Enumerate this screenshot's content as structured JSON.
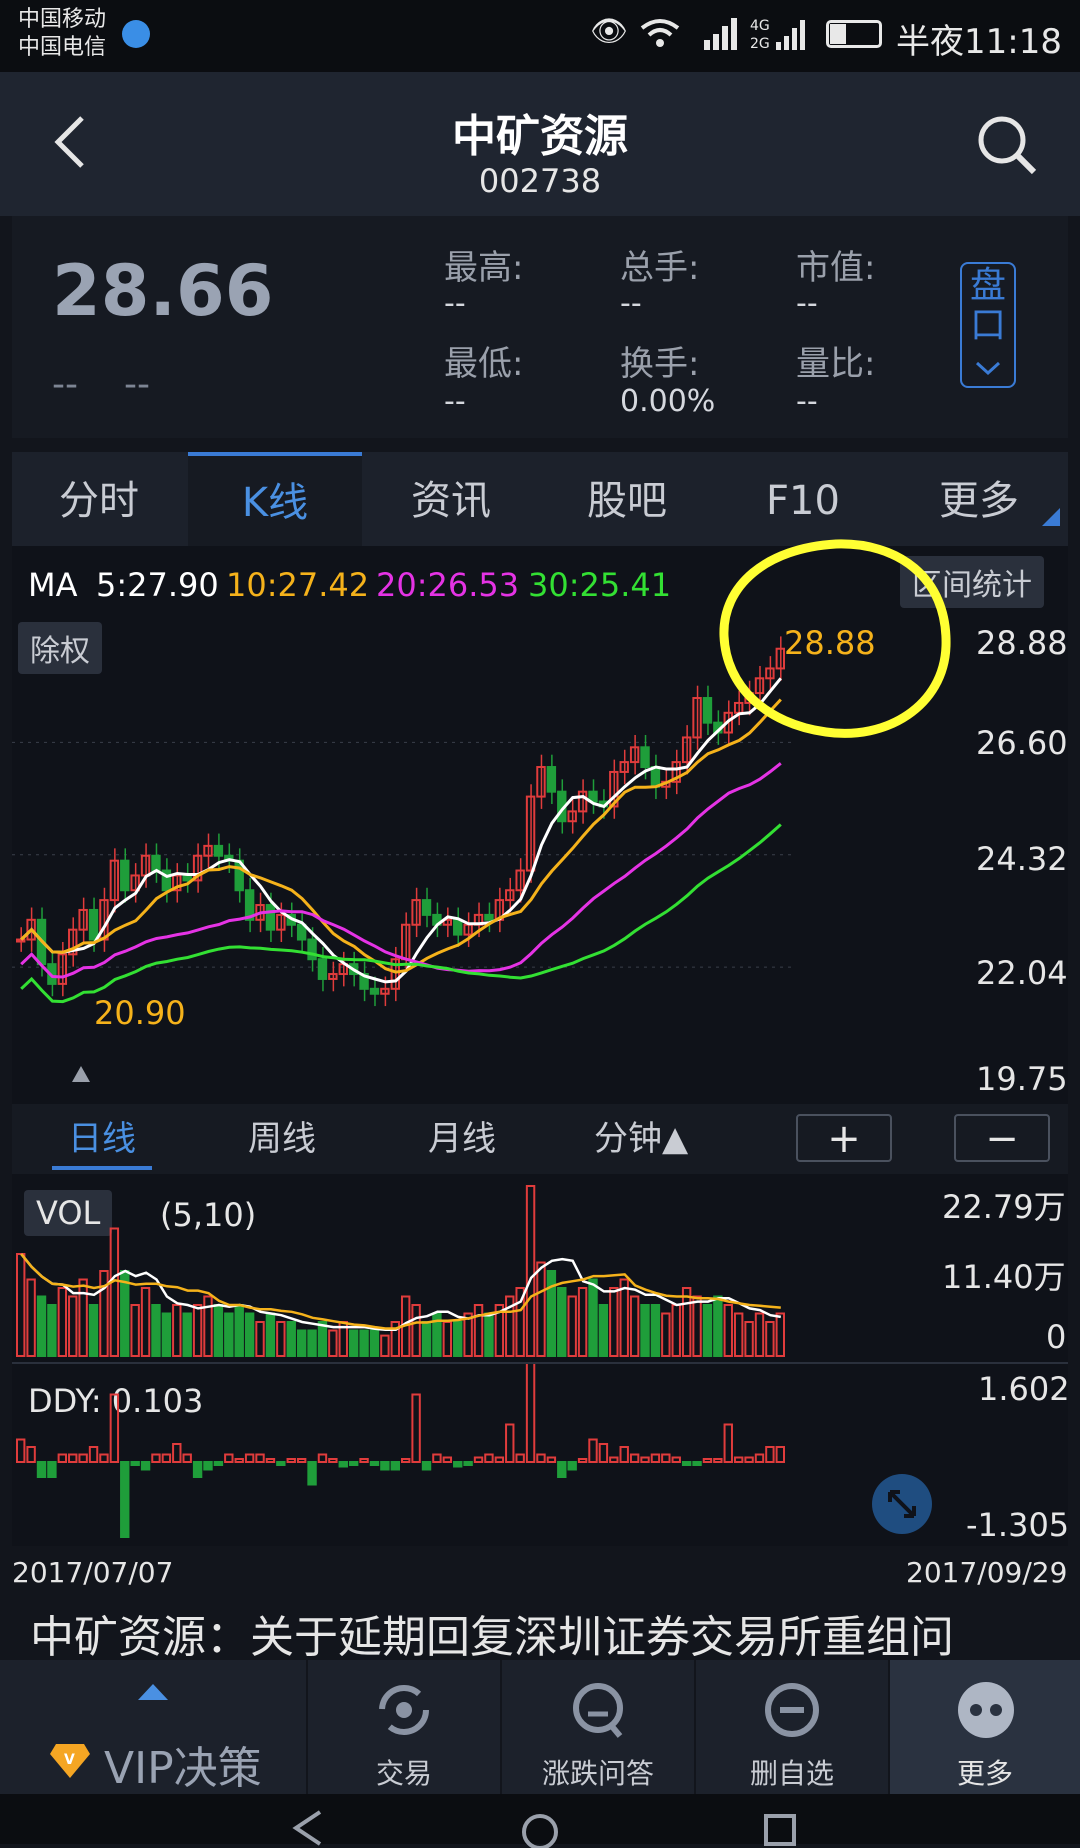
{
  "status_bar": {
    "carrier1": "中国移动",
    "carrier2": "中国电信",
    "network": "4G",
    "time": "半夜11:18"
  },
  "header": {
    "stock_name": "中矿资源",
    "stock_code": "002738"
  },
  "quote": {
    "price": "28.66",
    "change": "--",
    "change_pct": "--",
    "fields": [
      {
        "label": "最高:",
        "value": "--"
      },
      {
        "label": "总手:",
        "value": "--"
      },
      {
        "label": "市值:",
        "value": "--"
      },
      {
        "label": "最低:",
        "value": "--"
      },
      {
        "label": "换手:",
        "value": "0.00%"
      },
      {
        "label": "量比:",
        "value": "--"
      }
    ],
    "pankou_label1": "盘",
    "pankou_label2": "口"
  },
  "tabs": [
    "分时",
    "K线",
    "资讯",
    "股吧",
    "F10",
    "更多"
  ],
  "active_tab": "K线",
  "kline": {
    "ma_label": "MA",
    "ma5": "5:27.90",
    "ma10": "10:27.42",
    "ma20": "20:26.53",
    "ma30": "30:25.41",
    "ex_right_label": "除权",
    "range_stats_label": "区间统计",
    "high_marker": "28.88",
    "low_marker": "20.90",
    "y_ticks": [
      "28.88",
      "26.60",
      "24.32",
      "22.04",
      "19.75"
    ]
  },
  "periods": {
    "items": [
      "日线",
      "周线",
      "月线",
      "分钟▲"
    ],
    "active": "日线",
    "zoom_in": "+",
    "zoom_out": "−"
  },
  "volume": {
    "tag": "VOL",
    "params": "(5,10)",
    "y_ticks": [
      "22.79万",
      "11.40万",
      "0"
    ]
  },
  "ddy": {
    "label": "DDY: 0.103",
    "y_max": "1.602",
    "y_min": "-1.305"
  },
  "dates": {
    "start": "2017/07/07",
    "end": "2017/09/29"
  },
  "news_headline": "中矿资源：关于延期回复深圳证券交易所重组问",
  "bottom_nav": [
    {
      "label": "VIP决策",
      "icon": "vip-diamond-icon"
    },
    {
      "label": "交易",
      "icon": "trade-refresh-icon"
    },
    {
      "label": "涨跌问答",
      "icon": "qa-icon"
    },
    {
      "label": "删自选",
      "icon": "remove-favorite-icon"
    },
    {
      "label": "更多",
      "icon": "more-dots-icon"
    }
  ],
  "colors": {
    "up": "#e03c3c",
    "down": "#1f9e3a",
    "ma5": "#ffffff",
    "ma10": "#f5b21b",
    "ma20": "#e533e5",
    "ma30": "#33e033",
    "accent": "#4a90e2",
    "annotation": "#ffff33"
  }
}
